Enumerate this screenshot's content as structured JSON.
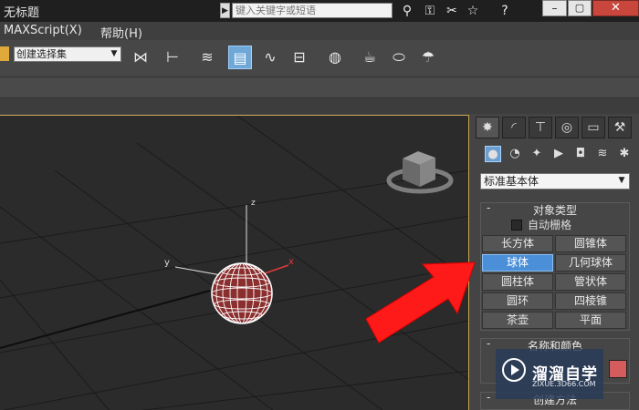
{
  "window": {
    "title": "无标题",
    "search_placeholder": "键入关键字或短语",
    "minimize": "–",
    "maximize": "▢",
    "close": "✕"
  },
  "title_icons": [
    "binoculars-icon",
    "key-icon",
    "tools-icon",
    "star-icon",
    "help-icon"
  ],
  "title_icon_glyphs": [
    "⚲",
    "⚿",
    "✂",
    "☆",
    "?"
  ],
  "menu": {
    "items": [
      {
        "label": "MAXScript(X)"
      },
      {
        "label": "帮助(H)"
      }
    ]
  },
  "toolbar": {
    "selection_set_value": "创建选择集",
    "tools": [
      {
        "name": "mirror-icon",
        "glyph": "⋈",
        "active": false
      },
      {
        "name": "align-icon",
        "glyph": "⊢",
        "active": false
      },
      {
        "name": "layers-icon",
        "glyph": "≋",
        "active": false
      },
      {
        "name": "scene-explorer-icon",
        "glyph": "▤",
        "active": true
      },
      {
        "name": "curve-editor-icon",
        "glyph": "∿",
        "active": false
      },
      {
        "name": "schematic-view-icon",
        "glyph": "⊟",
        "active": false
      },
      {
        "name": "material-editor-icon",
        "glyph": "◍",
        "active": false
      },
      {
        "name": "render-setup-icon",
        "glyph": "☕",
        "active": false
      },
      {
        "name": "render-frame-icon",
        "glyph": "⬭",
        "active": false
      },
      {
        "name": "render-icon",
        "glyph": "☂",
        "active": false
      }
    ]
  },
  "viewport": {
    "axis_labels": {
      "x": "x",
      "y": "y",
      "z": "z"
    },
    "colors": {
      "background": "#2b2b2b",
      "grid": "#1a1a1a",
      "sphere": "#ffffff",
      "sphere_fill": "#8b2e2e",
      "arrow": "#ff1a1a"
    }
  },
  "command_panel": {
    "tabs": [
      {
        "name": "create-tab",
        "glyph": "✸",
        "active": true
      },
      {
        "name": "modify-tab",
        "glyph": "◜",
        "active": false
      },
      {
        "name": "hierarchy-tab",
        "glyph": "⊤",
        "active": false
      },
      {
        "name": "motion-tab",
        "glyph": "◎",
        "active": false
      },
      {
        "name": "display-tab",
        "glyph": "▭",
        "active": false
      },
      {
        "name": "utilities-tab",
        "glyph": "⚒",
        "active": false
      }
    ],
    "categories": [
      {
        "name": "geometry-icon",
        "glyph": "●",
        "active": true
      },
      {
        "name": "shapes-icon",
        "glyph": "◔",
        "active": false
      },
      {
        "name": "lights-icon",
        "glyph": "✦",
        "active": false
      },
      {
        "name": "cameras-icon",
        "glyph": "▶",
        "active": false
      },
      {
        "name": "helpers-icon",
        "glyph": "◘",
        "active": false
      },
      {
        "name": "spacewarps-icon",
        "glyph": "≋",
        "active": false
      },
      {
        "name": "systems-icon",
        "glyph": "✱",
        "active": false
      }
    ],
    "primitive_type": "标准基本体",
    "object_type": {
      "minus": "-",
      "title": "对象类型",
      "autogrid_label": "自动栅格",
      "buttons": [
        {
          "label": "长方体",
          "active": false
        },
        {
          "label": "圆锥体",
          "active": false
        },
        {
          "label": "球体",
          "active": true
        },
        {
          "label": "几何球体",
          "active": false
        },
        {
          "label": "圆柱体",
          "active": false
        },
        {
          "label": "管状体",
          "active": false
        },
        {
          "label": "圆环",
          "active": false
        },
        {
          "label": "四棱锥",
          "active": false
        },
        {
          "label": "茶壶",
          "active": false
        },
        {
          "label": "平面",
          "active": false
        }
      ]
    },
    "name_color": {
      "minus": "-",
      "title": "名称和颜色",
      "swatch_color": "#d45c5c"
    },
    "creation_method": {
      "minus": "-",
      "title": "创建方法"
    }
  },
  "watermark": {
    "name": "溜溜自学",
    "url": "ZIXUE.3D66.COM"
  }
}
